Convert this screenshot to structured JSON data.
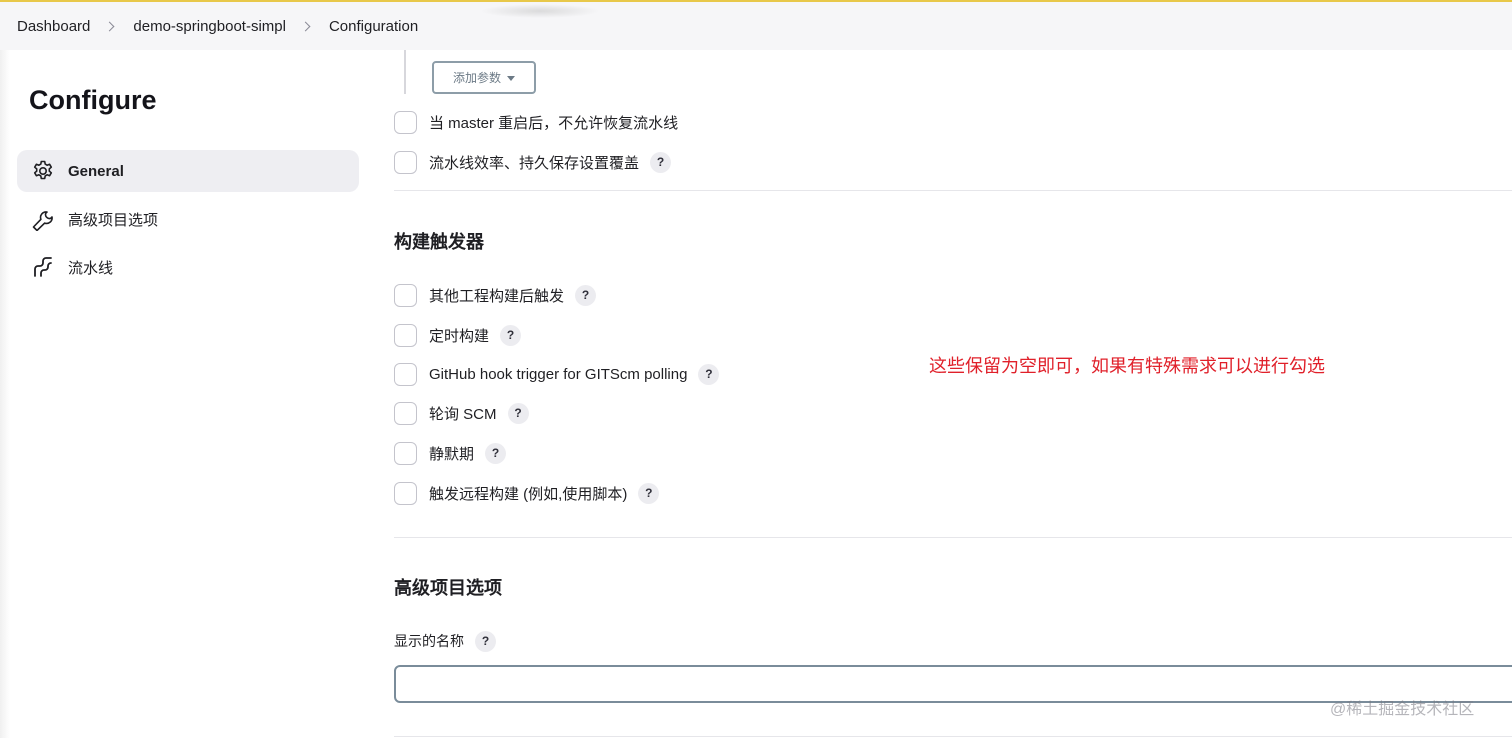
{
  "breadcrumb": {
    "items": [
      "Dashboard",
      "demo-springboot-simpl",
      "Configuration"
    ]
  },
  "sidebar": {
    "title": "Configure",
    "items": [
      {
        "label": "General",
        "icon": "gear-icon"
      },
      {
        "label": "高级项目选项",
        "icon": "wrench-icon"
      },
      {
        "label": "流水线",
        "icon": "pipeline-icon"
      }
    ]
  },
  "main": {
    "add_param_label": "添加参数",
    "general_options": [
      {
        "label": "当 master 重启后，不允许恢复流水线",
        "help": false
      },
      {
        "label": "流水线效率、持久保存设置覆盖",
        "help": true
      }
    ],
    "triggers": {
      "title": "构建触发器",
      "items": [
        {
          "label": "其他工程构建后触发",
          "help": true
        },
        {
          "label": "定时构建",
          "help": true
        },
        {
          "label": "GitHub hook trigger for GITScm polling",
          "help": true
        },
        {
          "label": "轮询 SCM",
          "help": true
        },
        {
          "label": "静默期",
          "help": true
        },
        {
          "label": "触发远程构建 (例如,使用脚本)",
          "help": true
        }
      ]
    },
    "advanced": {
      "title": "高级项目选项",
      "display_name_label": "显示的名称",
      "display_name_value": ""
    },
    "help_symbol": "?"
  },
  "annotation": "这些保留为空即可，如果有特殊需求可以进行勾选",
  "watermark": "@稀土掘金技术社区",
  "colors": {
    "accent_top": "#e8c84a",
    "annotation": "#e0202a",
    "sidebar_active": "#eeeef2"
  }
}
